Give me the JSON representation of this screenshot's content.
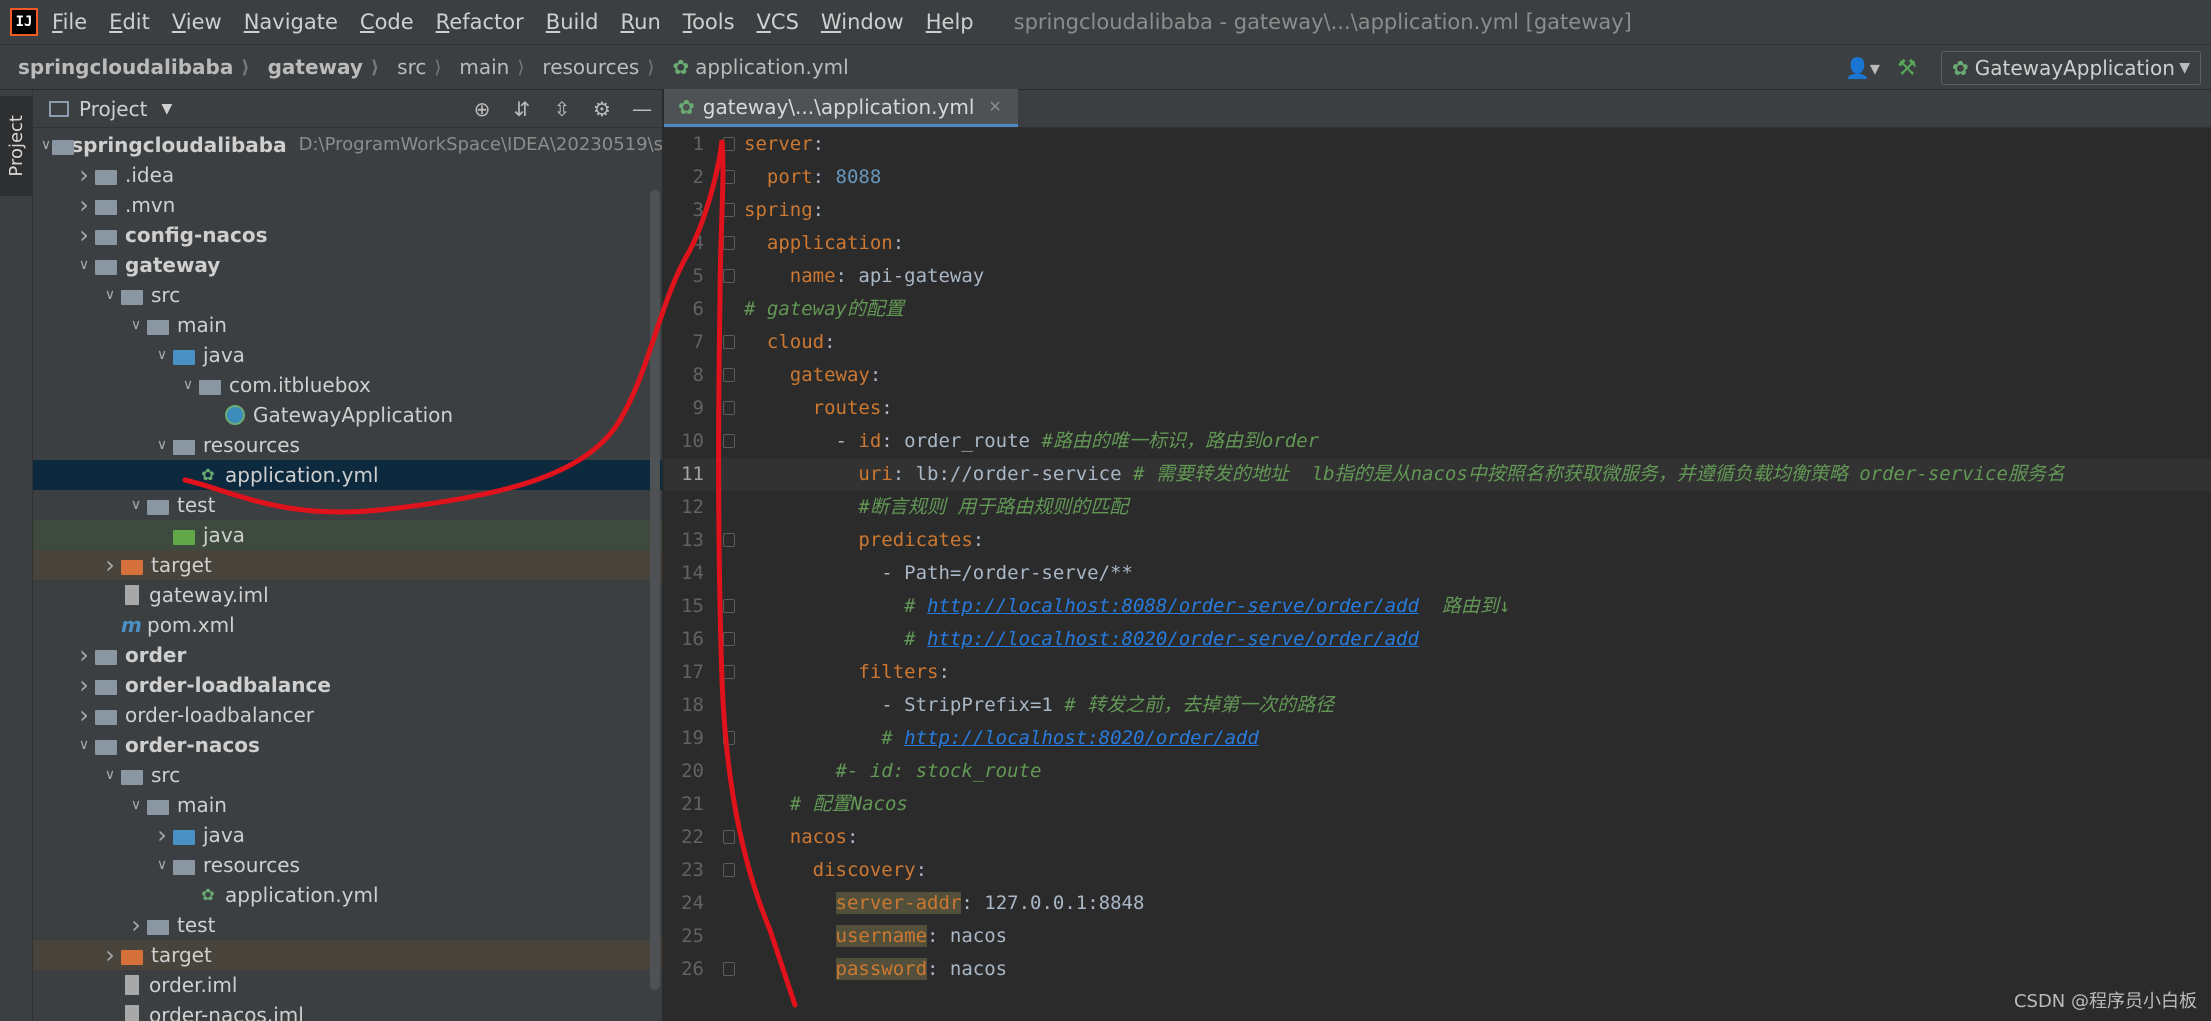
{
  "menubar": {
    "logo_text": "IJ",
    "items": [
      "File",
      "Edit",
      "View",
      "Navigate",
      "Code",
      "Refactor",
      "Build",
      "Run",
      "Tools",
      "VCS",
      "Window",
      "Help"
    ],
    "window_title": "springcloudalibaba - gateway\\...\\application.yml [gateway]"
  },
  "navbar": {
    "breadcrumbs": [
      "springcloudalibaba",
      "gateway",
      "src",
      "main",
      "resources",
      "application.yml"
    ],
    "run_config": "GatewayApplication",
    "icons": {
      "user": "user-icon",
      "build": "hammer-icon",
      "leaf": "spring-leaf-icon"
    }
  },
  "left_strip": {
    "project_tab": "Project"
  },
  "project_panel": {
    "title": "Project",
    "tree": [
      {
        "indent": 0,
        "arrow": "down",
        "icon": "module",
        "label": "springcloudalibaba",
        "bold": true,
        "hint": "D:\\ProgramWorkSpace\\IDEA\\20230519\\s"
      },
      {
        "indent": 1,
        "arrow": "right",
        "icon": "folder",
        "label": ".idea"
      },
      {
        "indent": 1,
        "arrow": "right",
        "icon": "folder",
        "label": ".mvn"
      },
      {
        "indent": 1,
        "arrow": "right",
        "icon": "module",
        "label": "config-nacos",
        "bold": true
      },
      {
        "indent": 1,
        "arrow": "down",
        "icon": "module",
        "label": "gateway",
        "bold": true
      },
      {
        "indent": 2,
        "arrow": "down",
        "icon": "folder",
        "label": "src"
      },
      {
        "indent": 3,
        "arrow": "down",
        "icon": "folder",
        "label": "main"
      },
      {
        "indent": 4,
        "arrow": "down",
        "icon": "blue",
        "label": "java"
      },
      {
        "indent": 5,
        "arrow": "down",
        "icon": "pkg",
        "label": "com.itbluebox"
      },
      {
        "indent": 6,
        "arrow": "none",
        "icon": "class",
        "label": "GatewayApplication"
      },
      {
        "indent": 4,
        "arrow": "down",
        "icon": "res",
        "label": "resources"
      },
      {
        "indent": 5,
        "arrow": "none",
        "icon": "leaf",
        "label": "application.yml",
        "selected": true
      },
      {
        "indent": 3,
        "arrow": "down",
        "icon": "folder",
        "label": "test"
      },
      {
        "indent": 4,
        "arrow": "none",
        "icon": "green",
        "label": "java",
        "row": "green"
      },
      {
        "indent": 2,
        "arrow": "right",
        "icon": "orange",
        "label": "target",
        "row": "orange"
      },
      {
        "indent": 2,
        "arrow": "none",
        "icon": "iml",
        "label": "gateway.iml"
      },
      {
        "indent": 2,
        "arrow": "none",
        "icon": "pom",
        "label": "pom.xml"
      },
      {
        "indent": 1,
        "arrow": "right",
        "icon": "module",
        "label": "order",
        "bold": true
      },
      {
        "indent": 1,
        "arrow": "right",
        "icon": "module",
        "label": "order-loadbalance",
        "bold": true
      },
      {
        "indent": 1,
        "arrow": "right",
        "icon": "folder",
        "label": "order-loadbalancer"
      },
      {
        "indent": 1,
        "arrow": "down",
        "icon": "module",
        "label": "order-nacos",
        "bold": true
      },
      {
        "indent": 2,
        "arrow": "down",
        "icon": "folder",
        "label": "src"
      },
      {
        "indent": 3,
        "arrow": "down",
        "icon": "folder",
        "label": "main"
      },
      {
        "indent": 4,
        "arrow": "right",
        "icon": "blue",
        "label": "java"
      },
      {
        "indent": 4,
        "arrow": "down",
        "icon": "res",
        "label": "resources"
      },
      {
        "indent": 5,
        "arrow": "none",
        "icon": "leaf",
        "label": "application.yml"
      },
      {
        "indent": 3,
        "arrow": "right",
        "icon": "folder",
        "label": "test"
      },
      {
        "indent": 2,
        "arrow": "right",
        "icon": "orange",
        "label": "target",
        "row": "orange"
      },
      {
        "indent": 2,
        "arrow": "none",
        "icon": "iml",
        "label": "order.iml"
      },
      {
        "indent": 2,
        "arrow": "none",
        "icon": "iml",
        "label": "order-nacos.iml"
      }
    ]
  },
  "editor": {
    "tab_label": "gateway\\...\\application.yml",
    "current_line": 11,
    "lines": [
      {
        "n": 1,
        "fold": true,
        "parts": [
          [
            "key",
            "server"
          ],
          [
            "colon",
            ":"
          ]
        ]
      },
      {
        "n": 2,
        "fold": true,
        "parts": [
          [
            "val",
            "  "
          ],
          [
            "key",
            "port"
          ],
          [
            "colon",
            ": "
          ],
          [
            "num",
            "8088"
          ]
        ]
      },
      {
        "n": 3,
        "fold": true,
        "parts": [
          [
            "key",
            "spring"
          ],
          [
            "colon",
            ":"
          ]
        ]
      },
      {
        "n": 4,
        "fold": true,
        "parts": [
          [
            "val",
            "  "
          ],
          [
            "key",
            "application"
          ],
          [
            "colon",
            ":"
          ]
        ]
      },
      {
        "n": 5,
        "fold": true,
        "parts": [
          [
            "val",
            "    "
          ],
          [
            "key",
            "name"
          ],
          [
            "colon",
            ": "
          ],
          [
            "val",
            "api-gateway"
          ]
        ]
      },
      {
        "n": 6,
        "fold": false,
        "parts": [
          [
            "comment",
            "# gateway的配置"
          ]
        ]
      },
      {
        "n": 7,
        "fold": true,
        "parts": [
          [
            "val",
            "  "
          ],
          [
            "key",
            "cloud"
          ],
          [
            "colon",
            ":"
          ]
        ]
      },
      {
        "n": 8,
        "fold": true,
        "parts": [
          [
            "val",
            "    "
          ],
          [
            "key",
            "gateway"
          ],
          [
            "colon",
            ":"
          ]
        ]
      },
      {
        "n": 9,
        "fold": true,
        "parts": [
          [
            "val",
            "      "
          ],
          [
            "key",
            "routes"
          ],
          [
            "colon",
            ":"
          ]
        ]
      },
      {
        "n": 10,
        "fold": true,
        "parts": [
          [
            "val",
            "        - "
          ],
          [
            "key",
            "id"
          ],
          [
            "colon",
            ": "
          ],
          [
            "val",
            "order_route "
          ],
          [
            "comment",
            "#路由的唯一标识，路由到order"
          ]
        ]
      },
      {
        "n": 11,
        "fold": false,
        "parts": [
          [
            "val",
            "          "
          ],
          [
            "key",
            "uri"
          ],
          [
            "colon",
            ": "
          ],
          [
            "val",
            "lb://order-service "
          ],
          [
            "comment",
            "# 需要转发的地址  lb指的是从nacos中按照名称获取微服务，并遵循负载均衡策略 order-service服务名"
          ]
        ]
      },
      {
        "n": 12,
        "fold": false,
        "parts": [
          [
            "val",
            "          "
          ],
          [
            "comment",
            "#断言规则 用于路由规则的匹配"
          ]
        ]
      },
      {
        "n": 13,
        "fold": true,
        "parts": [
          [
            "val",
            "          "
          ],
          [
            "key",
            "predicates"
          ],
          [
            "colon",
            ":"
          ]
        ]
      },
      {
        "n": 14,
        "fold": false,
        "parts": [
          [
            "val",
            "            - Path=/order-serve/**"
          ]
        ]
      },
      {
        "n": 15,
        "fold": true,
        "parts": [
          [
            "val",
            "              "
          ],
          [
            "comment",
            "# "
          ],
          [
            "url",
            "http://localhost:8088/order-serve/order/add"
          ],
          [
            "comment",
            "  路由到↓"
          ]
        ]
      },
      {
        "n": 16,
        "fold": true,
        "parts": [
          [
            "val",
            "              "
          ],
          [
            "comment",
            "# "
          ],
          [
            "url",
            "http://localhost:8020/order-serve/order/add"
          ]
        ]
      },
      {
        "n": 17,
        "fold": true,
        "parts": [
          [
            "val",
            "          "
          ],
          [
            "key",
            "filters"
          ],
          [
            "colon",
            ":"
          ]
        ]
      },
      {
        "n": 18,
        "fold": false,
        "parts": [
          [
            "val",
            "            - StripPrefix=1 "
          ],
          [
            "comment",
            "# 转发之前，去掉第一次的路径"
          ]
        ]
      },
      {
        "n": 19,
        "fold": true,
        "parts": [
          [
            "val",
            "            "
          ],
          [
            "comment",
            "# "
          ],
          [
            "url",
            "http://localhost:8020/order/add"
          ]
        ]
      },
      {
        "n": 20,
        "fold": false,
        "parts": [
          [
            "val",
            "        "
          ],
          [
            "comment",
            "#- id: stock_route"
          ]
        ]
      },
      {
        "n": 21,
        "fold": false,
        "parts": [
          [
            "val",
            "    "
          ],
          [
            "comment",
            "# 配置Nacos"
          ]
        ]
      },
      {
        "n": 22,
        "fold": true,
        "parts": [
          [
            "val",
            "    "
          ],
          [
            "key",
            "nacos"
          ],
          [
            "colon",
            ":"
          ]
        ]
      },
      {
        "n": 23,
        "fold": true,
        "parts": [
          [
            "val",
            "      "
          ],
          [
            "key",
            "discovery"
          ],
          [
            "colon",
            ":"
          ]
        ]
      },
      {
        "n": 24,
        "fold": false,
        "parts": [
          [
            "val",
            "        "
          ],
          [
            "hlkey",
            "server-addr"
          ],
          [
            "colon",
            ": "
          ],
          [
            "val",
            "127.0.0.1:8848"
          ]
        ]
      },
      {
        "n": 25,
        "fold": false,
        "parts": [
          [
            "val",
            "        "
          ],
          [
            "hlkey",
            "username"
          ],
          [
            "colon",
            ": "
          ],
          [
            "val",
            "nacos"
          ]
        ]
      },
      {
        "n": 26,
        "fold": true,
        "parts": [
          [
            "val",
            "        "
          ],
          [
            "hlkey",
            "password"
          ],
          [
            "colon",
            ": "
          ],
          [
            "val",
            "nacos"
          ]
        ]
      }
    ]
  },
  "watermark": "CSDN @程序员小白板",
  "colors": {
    "annotation_stroke": "#e0121b"
  }
}
